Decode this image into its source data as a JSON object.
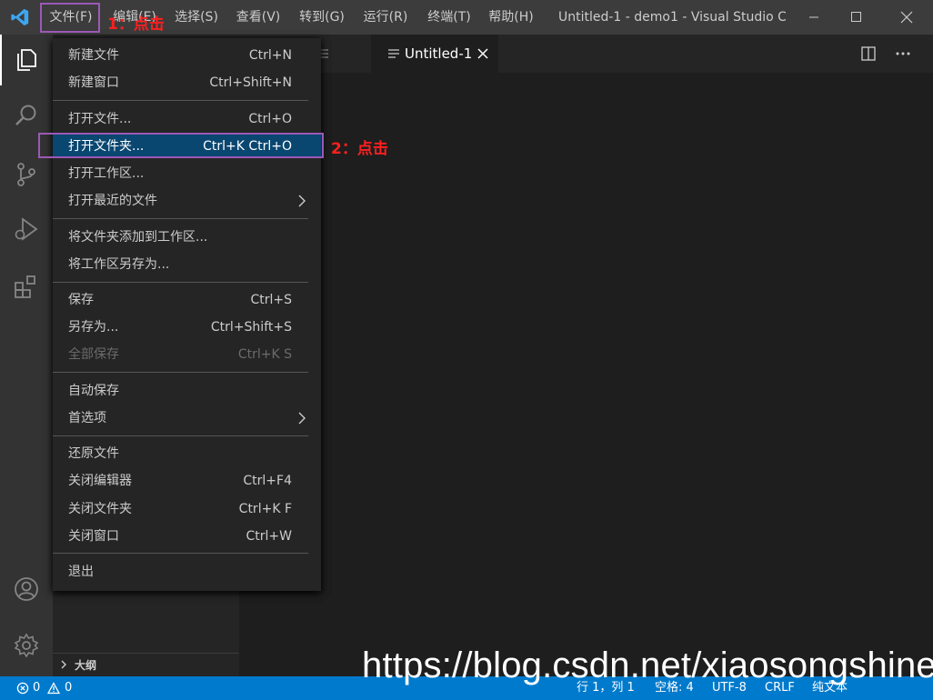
{
  "titlebar": {
    "menu": [
      "文件(F)",
      "编辑(E)",
      "选择(S)",
      "查看(V)",
      "转到(G)",
      "运行(R)",
      "终端(T)",
      "帮助(H)"
    ],
    "title": "Untitled-1 - demo1 - Visual Studio C..."
  },
  "tabs": {
    "active_label": "Untitled-1"
  },
  "sidebar": {
    "outline_label": "大纲"
  },
  "file_menu": {
    "items": [
      {
        "label": "新建文件",
        "shortcut": "Ctrl+N"
      },
      {
        "label": "新建窗口",
        "shortcut": "Ctrl+Shift+N"
      },
      {
        "label": "打开文件...",
        "shortcut": "Ctrl+O"
      },
      {
        "label": "打开文件夹...",
        "shortcut": "Ctrl+K Ctrl+O"
      },
      {
        "label": "打开工作区...",
        "shortcut": ""
      },
      {
        "label": "打开最近的文件",
        "shortcut": ""
      },
      {
        "label": "将文件夹添加到工作区...",
        "shortcut": ""
      },
      {
        "label": "将工作区另存为...",
        "shortcut": ""
      },
      {
        "label": "保存",
        "shortcut": "Ctrl+S"
      },
      {
        "label": "另存为...",
        "shortcut": "Ctrl+Shift+S"
      },
      {
        "label": "全部保存",
        "shortcut": "Ctrl+K S"
      },
      {
        "label": "自动保存",
        "shortcut": ""
      },
      {
        "label": "首选项",
        "shortcut": ""
      },
      {
        "label": "还原文件",
        "shortcut": ""
      },
      {
        "label": "关闭编辑器",
        "shortcut": "Ctrl+F4"
      },
      {
        "label": "关闭文件夹",
        "shortcut": "Ctrl+K F"
      },
      {
        "label": "关闭窗口",
        "shortcut": "Ctrl+W"
      },
      {
        "label": "退出",
        "shortcut": ""
      }
    ]
  },
  "annotations": {
    "step1": "1：点击",
    "step2": "2：点击"
  },
  "statusbar": {
    "errors": "0",
    "warnings": "0",
    "position": "行 1，列 1",
    "indent": "空格: 4",
    "encoding": "UTF-8",
    "eol": "CRLF",
    "language": "纯文本"
  },
  "watermark": "https://blog.csdn.net/xiaosongshine",
  "colors": {
    "accent": "#007acc",
    "selection": "#094771",
    "annotation_box": "#9b59b6",
    "annotation_text": "#ff1f1f"
  },
  "icons": [
    "vscode-logo-icon",
    "explorer-icon",
    "search-icon",
    "source-control-icon",
    "run-debug-icon",
    "extensions-icon",
    "account-icon",
    "settings-gear-icon",
    "split-editor-icon",
    "more-actions-icon",
    "close-icon",
    "chevron-right-icon",
    "error-icon",
    "warning-icon"
  ]
}
